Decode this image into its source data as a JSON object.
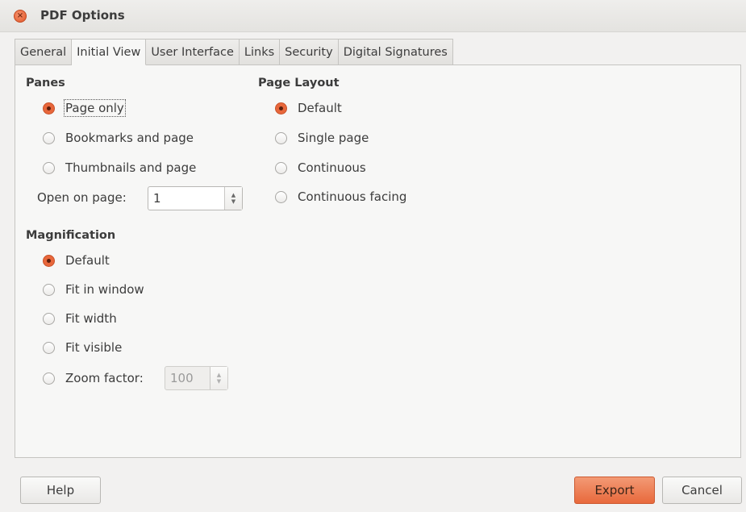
{
  "window": {
    "title": "PDF Options",
    "close_glyph": "×"
  },
  "tabs": [
    {
      "label": "General",
      "active": false
    },
    {
      "label": "Initial View",
      "active": true
    },
    {
      "label": "User Interface",
      "active": false
    },
    {
      "label": "Links",
      "active": false
    },
    {
      "label": "Security",
      "active": false
    },
    {
      "label": "Digital Signatures",
      "active": false
    }
  ],
  "panes": {
    "title": "Panes",
    "options": [
      {
        "label": "Page only",
        "checked": true
      },
      {
        "label": "Bookmarks and page",
        "checked": false
      },
      {
        "label": "Thumbnails and page",
        "checked": false
      }
    ],
    "open_on_page_label": "Open on page:",
    "open_on_page_value": "1"
  },
  "page_layout": {
    "title": "Page Layout",
    "options": [
      {
        "label": "Default",
        "checked": true
      },
      {
        "label": "Single page",
        "checked": false
      },
      {
        "label": "Continuous",
        "checked": false
      },
      {
        "label": "Continuous facing",
        "checked": false
      }
    ]
  },
  "magnification": {
    "title": "Magnification",
    "options": [
      {
        "label": "Default",
        "checked": true
      },
      {
        "label": "Fit in window",
        "checked": false
      },
      {
        "label": "Fit width",
        "checked": false
      },
      {
        "label": "Fit visible",
        "checked": false
      },
      {
        "label": "Zoom factor:",
        "checked": false
      }
    ],
    "zoom_value": "100"
  },
  "buttons": {
    "help": "Help",
    "export": "Export",
    "cancel": "Cancel"
  },
  "colors": {
    "accent": "#e8673b",
    "panel": "#f7f7f6",
    "background": "#f2f1f0"
  }
}
